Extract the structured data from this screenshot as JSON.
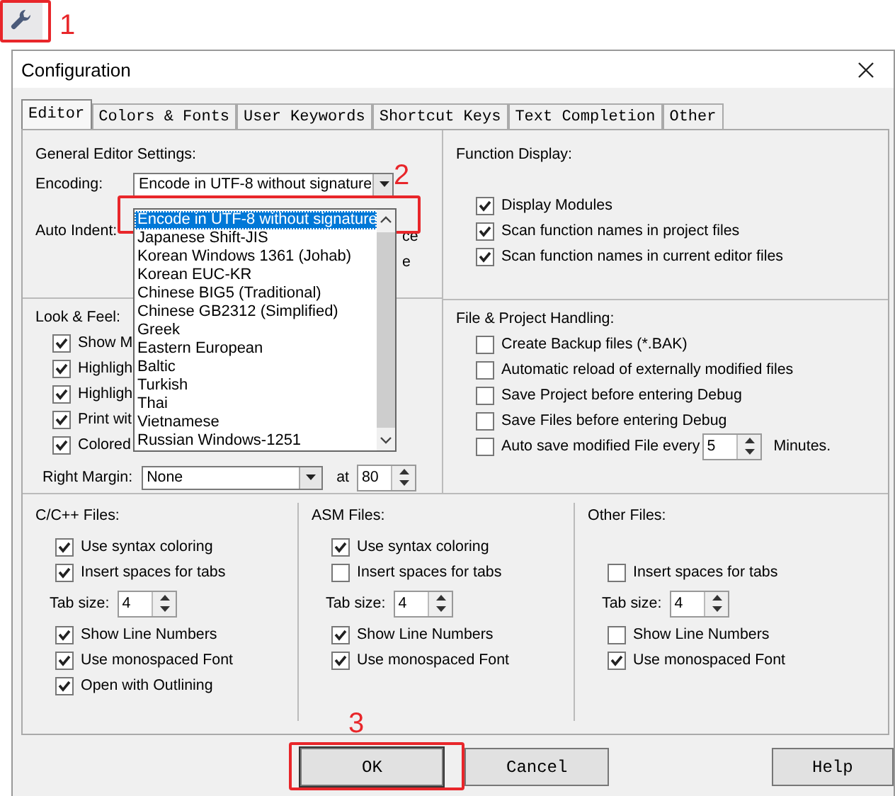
{
  "annotations": [
    {
      "label": "1"
    },
    {
      "label": "2"
    },
    {
      "label": "3"
    }
  ],
  "window": {
    "title": "Configuration"
  },
  "tabs": [
    {
      "label": "Editor",
      "selected": true
    },
    {
      "label": "Colors & Fonts",
      "selected": false
    },
    {
      "label": "User Keywords",
      "selected": false
    },
    {
      "label": "Shortcut Keys",
      "selected": false
    },
    {
      "label": "Text Completion",
      "selected": false
    },
    {
      "label": "Other",
      "selected": false
    }
  ],
  "general_editor_settings": {
    "title": "General Editor Settings:",
    "encoding": {
      "label": "Encoding:",
      "value": "Encode in UTF-8 without signature"
    },
    "auto_indent": {
      "label": "Auto Indent:",
      "fragments": [
        "ce",
        "e"
      ]
    }
  },
  "encoding_list": {
    "items": [
      {
        "label": "Encode in UTF-8 without signature",
        "selected": true
      },
      {
        "label": "Japanese Shift-JIS",
        "selected": false
      },
      {
        "label": "Korean Windows 1361 (Johab)",
        "selected": false
      },
      {
        "label": "Korean EUC-KR",
        "selected": false
      },
      {
        "label": "Chinese BIG5 (Traditional)",
        "selected": false
      },
      {
        "label": "Chinese GB2312 (Simplified)",
        "selected": false
      },
      {
        "label": "Greek",
        "selected": false
      },
      {
        "label": "Eastern European",
        "selected": false
      },
      {
        "label": "Baltic",
        "selected": false
      },
      {
        "label": "Turkish",
        "selected": false
      },
      {
        "label": "Thai",
        "selected": false
      },
      {
        "label": "Vietnamese",
        "selected": false
      },
      {
        "label": "Russian Windows-1251",
        "selected": false
      }
    ]
  },
  "function_display": {
    "title": "Function Display:",
    "options": [
      {
        "label": "Display Modules",
        "checked": true
      },
      {
        "label": "Scan function names in project files",
        "checked": true
      },
      {
        "label": "Scan function names in current editor files",
        "checked": true
      }
    ]
  },
  "look_and_feel": {
    "title": "Look & Feel:",
    "options": [
      {
        "label": "Show M",
        "checked": true
      },
      {
        "label": "Highligh",
        "checked": true
      },
      {
        "label": "Highligh",
        "checked": true
      },
      {
        "label": "Print wit",
        "checked": true
      },
      {
        "label": "Colored",
        "checked": true
      }
    ],
    "right_margin": {
      "label": "Right Margin:",
      "value": "None",
      "at_label": "at",
      "column": "80"
    }
  },
  "file_project_handling": {
    "title": "File & Project Handling:",
    "options": [
      {
        "label": "Create Backup files (*.BAK)",
        "checked": false
      },
      {
        "label": "Automatic reload of externally modified files",
        "checked": false
      },
      {
        "label": "Save Project before entering Debug",
        "checked": false
      },
      {
        "label": "Save Files before entering Debug",
        "checked": false
      }
    ],
    "autosave": {
      "label": "Auto save modified File every",
      "checked": false,
      "minutes": "5",
      "unit": "Minutes."
    }
  },
  "file_types": [
    {
      "title": "C/C++ Files:",
      "options": [
        {
          "kind": "check",
          "label": "Use syntax coloring",
          "checked": true
        },
        {
          "kind": "check",
          "label": "Insert spaces for tabs",
          "checked": true
        },
        {
          "kind": "tab_size",
          "label": "Tab size:",
          "value": "4"
        },
        {
          "kind": "check",
          "label": "Show Line Numbers",
          "checked": true
        },
        {
          "kind": "check",
          "label": "Use monospaced Font",
          "checked": true
        },
        {
          "kind": "check",
          "label": "Open with Outlining",
          "checked": true
        }
      ]
    },
    {
      "title": "ASM Files:",
      "options": [
        {
          "kind": "check",
          "label": "Use syntax coloring",
          "checked": true
        },
        {
          "kind": "check",
          "label": "Insert spaces for tabs",
          "checked": false
        },
        {
          "kind": "tab_size",
          "label": "Tab size:",
          "value": "4"
        },
        {
          "kind": "check",
          "label": "Show Line Numbers",
          "checked": true
        },
        {
          "kind": "check",
          "label": "Use monospaced Font",
          "checked": true
        }
      ]
    },
    {
      "title": "Other Files:",
      "options": [
        {
          "kind": "check",
          "label": "Insert spaces for tabs",
          "checked": false
        },
        {
          "kind": "tab_size",
          "label": "Tab size:",
          "value": "4"
        },
        {
          "kind": "check",
          "label": "Show Line Numbers",
          "checked": false
        },
        {
          "kind": "check",
          "label": "Use monospaced Font",
          "checked": true
        }
      ]
    }
  ],
  "buttons": [
    {
      "label": "OK"
    },
    {
      "label": "Cancel"
    },
    {
      "label": "Help"
    }
  ]
}
